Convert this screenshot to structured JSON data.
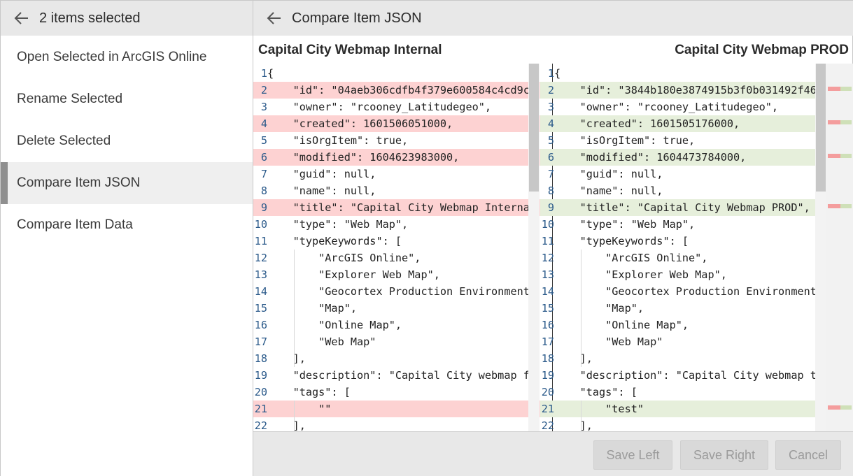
{
  "sidebar": {
    "title": "2 items selected",
    "items": [
      {
        "label": "Open Selected in ArcGIS Online"
      },
      {
        "label": "Rename Selected"
      },
      {
        "label": "Delete Selected"
      },
      {
        "label": "Compare Item JSON"
      },
      {
        "label": "Compare Item Data"
      }
    ],
    "active_item": "Compare Item JSON"
  },
  "panel": {
    "title": "Compare Item JSON",
    "left_doc_title": "Capital City Webmap Internal",
    "right_doc_title": "Capital City Webmap PROD"
  },
  "left_code": [
    {
      "n": "1",
      "text": "{",
      "type": ""
    },
    {
      "n": "2",
      "text": "    \"id\": \"04aeb306cdfb4f379e600584c4cd9c",
      "type": "del"
    },
    {
      "n": "3",
      "text": "    \"owner\": \"rcooney_Latitudegeo\",",
      "type": ""
    },
    {
      "n": "4",
      "text": "    \"created\": 1601506051000,",
      "type": "del"
    },
    {
      "n": "5",
      "text": "    \"isOrgItem\": true,",
      "type": ""
    },
    {
      "n": "6",
      "text": "    \"modified\": 1604623983000,",
      "type": "del"
    },
    {
      "n": "7",
      "text": "    \"guid\": null,",
      "type": ""
    },
    {
      "n": "8",
      "text": "    \"name\": null,",
      "type": ""
    },
    {
      "n": "9",
      "text": "    \"title\": \"Capital City Webmap Interna",
      "type": "del"
    },
    {
      "n": "10",
      "text": "    \"type\": \"Web Map\",",
      "type": ""
    },
    {
      "n": "11",
      "text": "    \"typeKeywords\": [",
      "type": ""
    },
    {
      "n": "12",
      "text": "        \"ArcGIS Online\",",
      "type": ""
    },
    {
      "n": "13",
      "text": "        \"Explorer Web Map\",",
      "type": ""
    },
    {
      "n": "14",
      "text": "        \"Geocortex Production Environment",
      "type": ""
    },
    {
      "n": "15",
      "text": "        \"Map\",",
      "type": ""
    },
    {
      "n": "16",
      "text": "        \"Online Map\",",
      "type": ""
    },
    {
      "n": "17",
      "text": "        \"Web Map\"",
      "type": ""
    },
    {
      "n": "18",
      "text": "    ],",
      "type": ""
    },
    {
      "n": "19",
      "text": "    \"description\": \"Capital City webmap f",
      "type": ""
    },
    {
      "n": "20",
      "text": "    \"tags\": [",
      "type": ""
    },
    {
      "n": "21",
      "text": "        \"\"",
      "type": "del"
    },
    {
      "n": "22",
      "text": "    ],",
      "type": ""
    }
  ],
  "right_code": [
    {
      "n": "1",
      "text": "{",
      "type": ""
    },
    {
      "n": "2",
      "text": "    \"id\": \"3844b180e3874915b3f0b031492f46",
      "type": "ins"
    },
    {
      "n": "3",
      "text": "    \"owner\": \"rcooney_Latitudegeo\",",
      "type": ""
    },
    {
      "n": "4",
      "text": "    \"created\": 1601505176000,",
      "type": "ins"
    },
    {
      "n": "5",
      "text": "    \"isOrgItem\": true,",
      "type": ""
    },
    {
      "n": "6",
      "text": "    \"modified\": 1604473784000,",
      "type": "ins"
    },
    {
      "n": "7",
      "text": "    \"guid\": null,",
      "type": ""
    },
    {
      "n": "8",
      "text": "    \"name\": null,",
      "type": ""
    },
    {
      "n": "9",
      "text": "    \"title\": \"Capital City Webmap PROD\",",
      "type": "ins"
    },
    {
      "n": "10",
      "text": "    \"type\": \"Web Map\",",
      "type": ""
    },
    {
      "n": "11",
      "text": "    \"typeKeywords\": [",
      "type": ""
    },
    {
      "n": "12",
      "text": "        \"ArcGIS Online\",",
      "type": ""
    },
    {
      "n": "13",
      "text": "        \"Explorer Web Map\",",
      "type": ""
    },
    {
      "n": "14",
      "text": "        \"Geocortex Production Environment",
      "type": ""
    },
    {
      "n": "15",
      "text": "        \"Map\",",
      "type": ""
    },
    {
      "n": "16",
      "text": "        \"Online Map\",",
      "type": ""
    },
    {
      "n": "17",
      "text": "        \"Web Map\"",
      "type": ""
    },
    {
      "n": "18",
      "text": "    ],",
      "type": ""
    },
    {
      "n": "19",
      "text": "    \"description\": \"Capital City webmap t",
      "type": ""
    },
    {
      "n": "20",
      "text": "    \"tags\": [",
      "type": ""
    },
    {
      "n": "21",
      "text": "        \"test\"",
      "type": "ins"
    },
    {
      "n": "22",
      "text": "    ],",
      "type": ""
    }
  ],
  "footer": {
    "save_left": "Save Left",
    "save_right": "Save Right",
    "cancel": "Cancel"
  },
  "icons": {
    "back": "arrow-left-icon"
  },
  "colors": {
    "deleted_line": "#fdd2d2",
    "deleted_word": "#f49d9d",
    "inserted_line": "#e6efdb",
    "inserted_word": "#cfe0b8",
    "line_number": "#2b5a8a",
    "header_bg": "#e8e8e8"
  }
}
